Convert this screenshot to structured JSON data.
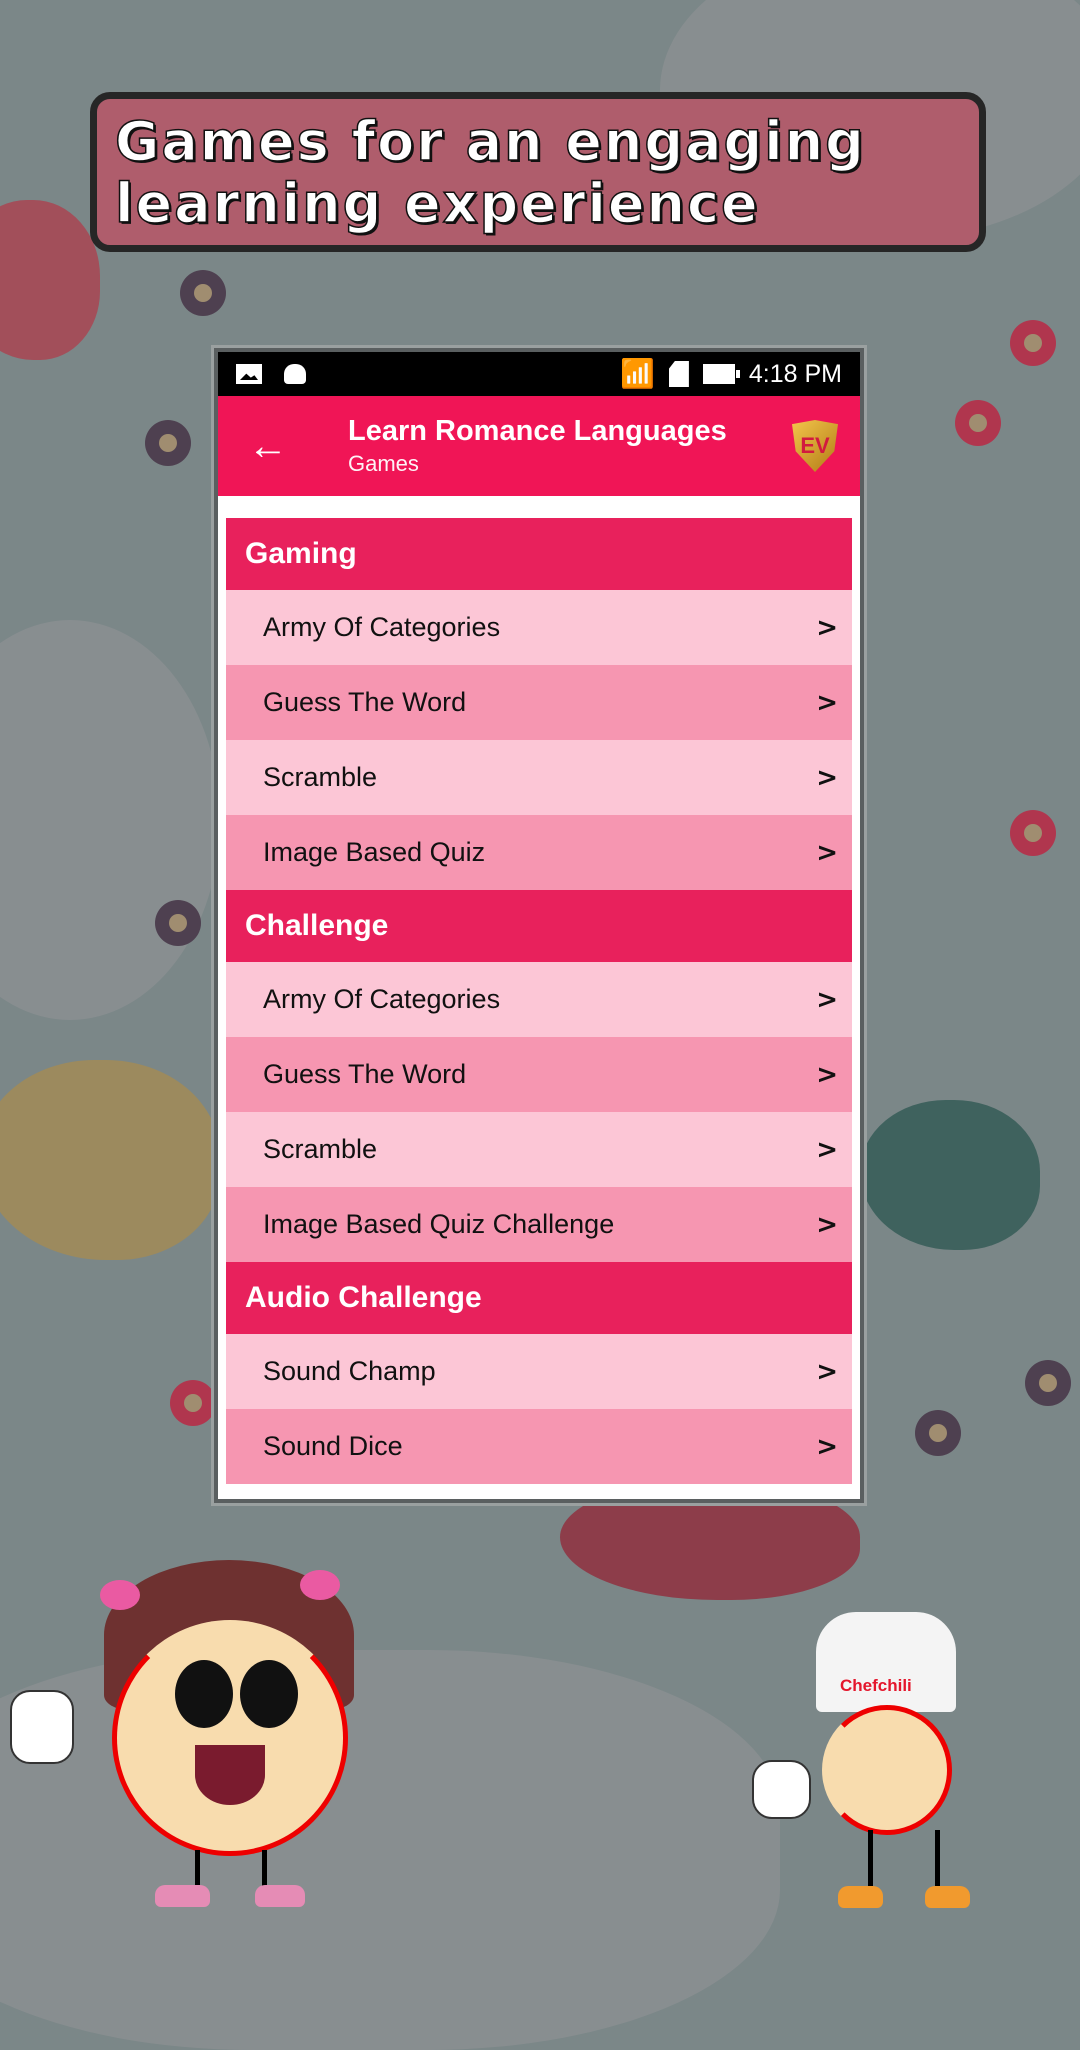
{
  "banner": {
    "text": "Games for an engaging learning experience"
  },
  "status_bar": {
    "left_icons": [
      "image-icon",
      "android-icon"
    ],
    "right_icons": [
      "wifi-icon",
      "data-arrows-icon",
      "sd-card-error-icon",
      "battery-icon"
    ],
    "time": "4:18 PM"
  },
  "app_bar": {
    "back_icon": "arrow-left-icon",
    "title": "Learn Romance Languages",
    "subtitle": "Games",
    "logo_text": "EV"
  },
  "colors": {
    "primary": "#f01556",
    "section_header": "#e8215c",
    "row_light": "#fcc6d6",
    "row_dark": "#f696b1",
    "banner": "#af5d6c"
  },
  "sections": [
    {
      "title": "Gaming",
      "items": [
        {
          "label": "Army Of Categories"
        },
        {
          "label": "Guess The Word"
        },
        {
          "label": "Scramble"
        },
        {
          "label": "Image Based Quiz"
        }
      ]
    },
    {
      "title": "Challenge",
      "items": [
        {
          "label": "Army Of Categories"
        },
        {
          "label": "Guess The Word"
        },
        {
          "label": "Scramble"
        },
        {
          "label": "Image Based Quiz Challenge"
        }
      ]
    },
    {
      "title": "Audio Challenge",
      "items": [
        {
          "label": "Sound Champ"
        },
        {
          "label": "Sound Dice"
        }
      ]
    }
  ],
  "chevron": ">",
  "mascot": {
    "chef_hat_text": "Chefchili"
  }
}
